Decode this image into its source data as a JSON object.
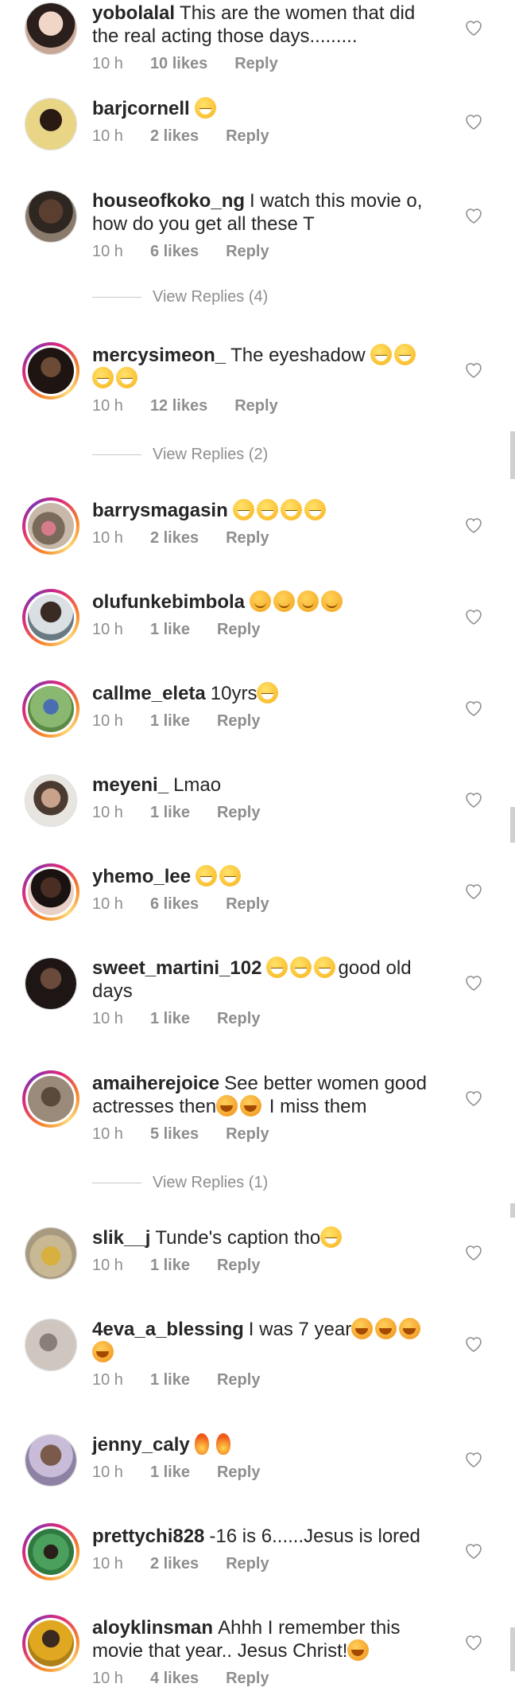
{
  "comments": [
    {
      "username": "yobolalal",
      "text": "This are the women that did the real acting those days.........",
      "time": "10 h",
      "likes": "10 likes",
      "reply": "Reply",
      "story": false,
      "avatar_color": "#c9a796"
    },
    {
      "username": "barjcornell",
      "text": "",
      "emojis": "grin",
      "time": "10 h",
      "likes": "2 likes",
      "reply": "Reply",
      "story": false,
      "avatar_color": "#e3d48a"
    },
    {
      "username": "houseofkoko_ng",
      "text": "I watch this movie o, how do you get all these T",
      "time": "10 h",
      "likes": "6 likes",
      "reply": "Reply",
      "story": false,
      "avatar_color": "#6e5d4f",
      "view_replies": "View Replies (4)"
    },
    {
      "username": "mercysimeon_",
      "text": "The eyeshadow",
      "time": "10 h",
      "likes": "12 likes",
      "reply": "Reply",
      "story": true,
      "avatar_color": "#4a3328",
      "view_replies": "View Replies (2)"
    },
    {
      "username": "barrysmagasin",
      "text": "",
      "time": "10 h",
      "likes": "2 likes",
      "reply": "Reply",
      "story": true,
      "avatar_color": "#b39b8f"
    },
    {
      "username": "olufunkebimbola",
      "text": "",
      "time": "10 h",
      "likes": "1 like",
      "reply": "Reply",
      "story": true,
      "avatar_color": "#5a6a72"
    },
    {
      "username": "callme_eleta",
      "text": "10yrs",
      "time": "10 h",
      "likes": "1 like",
      "reply": "Reply",
      "story": true,
      "avatar_color": "#7fa36b"
    },
    {
      "username": "meyeni_",
      "text": "Lmao",
      "time": "10 h",
      "likes": "1 like",
      "reply": "Reply",
      "story": false,
      "avatar_color": "#a89e9a"
    },
    {
      "username": "yhemo_lee",
      "text": "",
      "time": "10 h",
      "likes": "6 likes",
      "reply": "Reply",
      "story": true,
      "avatar_color": "#3a2c2a"
    },
    {
      "username": "sweet_martini_102",
      "text": "good old days",
      "time": "10 h",
      "likes": "1 like",
      "reply": "Reply",
      "story": false,
      "avatar_color": "#2b1d19"
    },
    {
      "username": "amaiherejoice",
      "text": "See better women good actresses then",
      "text2": "I miss them",
      "time": "10 h",
      "likes": "5 likes",
      "reply": "Reply",
      "story": true,
      "avatar_color": "#6e5a4a",
      "view_replies": "View Replies (1)"
    },
    {
      "username": "slik__j",
      "text": "Tunde's caption tho",
      "time": "10 h",
      "likes": "1 like",
      "reply": "Reply",
      "story": false,
      "avatar_color": "#c8b184"
    },
    {
      "username": "4eva_a_blessing",
      "text": "I was 7 year",
      "time": "10 h",
      "likes": "1 like",
      "reply": "Reply",
      "story": false,
      "avatar_color": "#b6aca6"
    },
    {
      "username": "jenny_caly",
      "text": "",
      "time": "10 h",
      "likes": "1 like",
      "reply": "Reply",
      "story": false,
      "avatar_color": "#9b8fb0"
    },
    {
      "username": "prettychi828",
      "text": "-16 is 6......Jesus is lored",
      "time": "10 h",
      "likes": "2 likes",
      "reply": "Reply",
      "story": true,
      "avatar_color": "#3e8a52"
    },
    {
      "username": "aloyklinsman",
      "text": "Ahhh I remember this movie that year.. Jesus Christ!",
      "time": "10 h",
      "likes": "4 likes",
      "reply": "Reply",
      "story": true,
      "avatar_color": "#d8a21f"
    }
  ],
  "colors": {
    "username": "#262626",
    "meta": "#8e8e8e",
    "story_ring": "#dd2a7b"
  }
}
